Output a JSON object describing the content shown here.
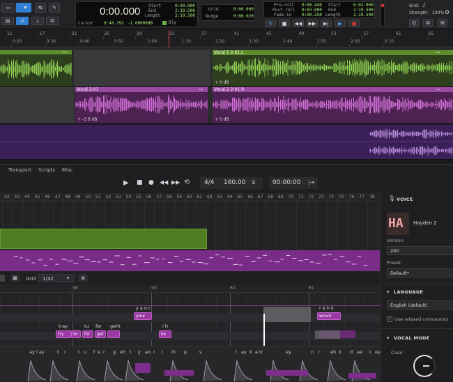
{
  "transport_top": {
    "counter": "0:00.000",
    "cursor_label": "Cursor",
    "cursor_value": "0:48.792",
    "cursor_value2": "-1.00000dB",
    "start_label": "Start",
    "end_label": "End",
    "length_label": "Length",
    "start_value": "0:00.000",
    "end_value": "2:19.500",
    "length_value": "2:19.500",
    "grid_label": "Grid",
    "nudge_label": "Nudge",
    "grid_value": "0:00.000",
    "nudge_value": "0:00.020",
    "preroll_label": "Pre-roll",
    "postroll_label": "Post-roll",
    "fadein_label": "Fade-in",
    "preroll_value": "0:08.440",
    "postroll_value": "0:03.000",
    "fadein_value": "0:00.250",
    "start2_value": "0:02.000",
    "end2_value": "2:19.500",
    "length2_value": "2:19.500",
    "grid_right_label": "Grid:",
    "strength_label": "Strength:",
    "strength_value": "100%",
    "dly_label": "Dly"
  },
  "ruler_top": {
    "bars": [
      "11",
      "17",
      "21",
      "25",
      "29",
      "33",
      "37",
      "41",
      "45",
      "49",
      "53",
      "57",
      "61",
      "65"
    ],
    "times": [
      "0:20",
      "0:30",
      "0:40",
      "0:50",
      "1:00",
      "1:10",
      "1:20",
      "1:30",
      "1:40",
      "1:50",
      "2:00",
      "2:10"
    ]
  },
  "clips": {
    "vocal1": "Vocal 1 2-01.L",
    "vocal1_gain": "+ 0 dB",
    "vocal2": "Vocal 2-01",
    "vocal2_gain": "+ -3.6 dB",
    "vocal2b": "Vocal 2 2-01.R",
    "vocal2b_gain": "+ 0 dB"
  },
  "plugin_menu": [
    "Transport",
    "Scripts",
    "Misc"
  ],
  "plugin_transport": {
    "time_sig": "4/4",
    "tempo": "160.00",
    "position": "00:00:00"
  },
  "plugin_ruler": [
    "42",
    "43",
    "44",
    "45",
    "46",
    "47",
    "48",
    "49",
    "50",
    "51",
    "52",
    "53",
    "54",
    "55",
    "56",
    "57",
    "58",
    "59",
    "60",
    "61",
    "62",
    "63",
    "64",
    "65",
    "66",
    "67",
    "68",
    "69",
    "70",
    "71",
    "72",
    "73",
    "74",
    "75",
    "76",
    "77",
    "78"
  ],
  "editor": {
    "grid_label": "Grid",
    "grid_value": "1/32",
    "bars": [
      "58",
      "59",
      "60",
      "61"
    ]
  },
  "lyrics": [
    {
      "t": "tray"
    },
    {
      "t": "tu"
    },
    {
      "t": "fer"
    },
    {
      "t": "geht"
    },
    {
      "t": "y a o r"
    },
    {
      "t": "i h"
    },
    {
      "t": "r e h k"
    }
  ],
  "notes": [
    {
      "t": "try"
    },
    {
      "t": "to"
    },
    {
      "t": "for"
    },
    {
      "t": "get"
    },
    {
      "t": "your"
    },
    {
      "t": "lie"
    },
    {
      "t": "wreck"
    }
  ],
  "phonemes": [
    "ay",
    "l ay",
    "t",
    "r",
    "t",
    "u",
    "f",
    "e",
    "r",
    "g",
    "eh",
    "t",
    "y",
    "ao",
    "r",
    "l",
    "ih",
    "p",
    "s",
    "l",
    "ay",
    "k",
    "a",
    "tr",
    "ey",
    "n",
    "r",
    "eh",
    "k",
    "d",
    "ae",
    "t",
    "ey"
  ],
  "voice_panel": {
    "title": "VOICE",
    "avatar_text": "HA",
    "voice_name": "Hayden 2",
    "version_label": "Version",
    "version_value": "200",
    "preset_label": "Preset",
    "preset_value": "Default*",
    "language_title": "LANGUAGE",
    "language_value": "English (default)",
    "relaxed_label": "Use relaxed consonants",
    "vocal_mode_title": "VOCAL MODE",
    "clear_label": "Clear"
  },
  "colors": {
    "green": "#6a9a32",
    "purple": "#9a4aa2",
    "lane_purple": "#3b1f58",
    "accent_blue": "#2f7fd6"
  }
}
